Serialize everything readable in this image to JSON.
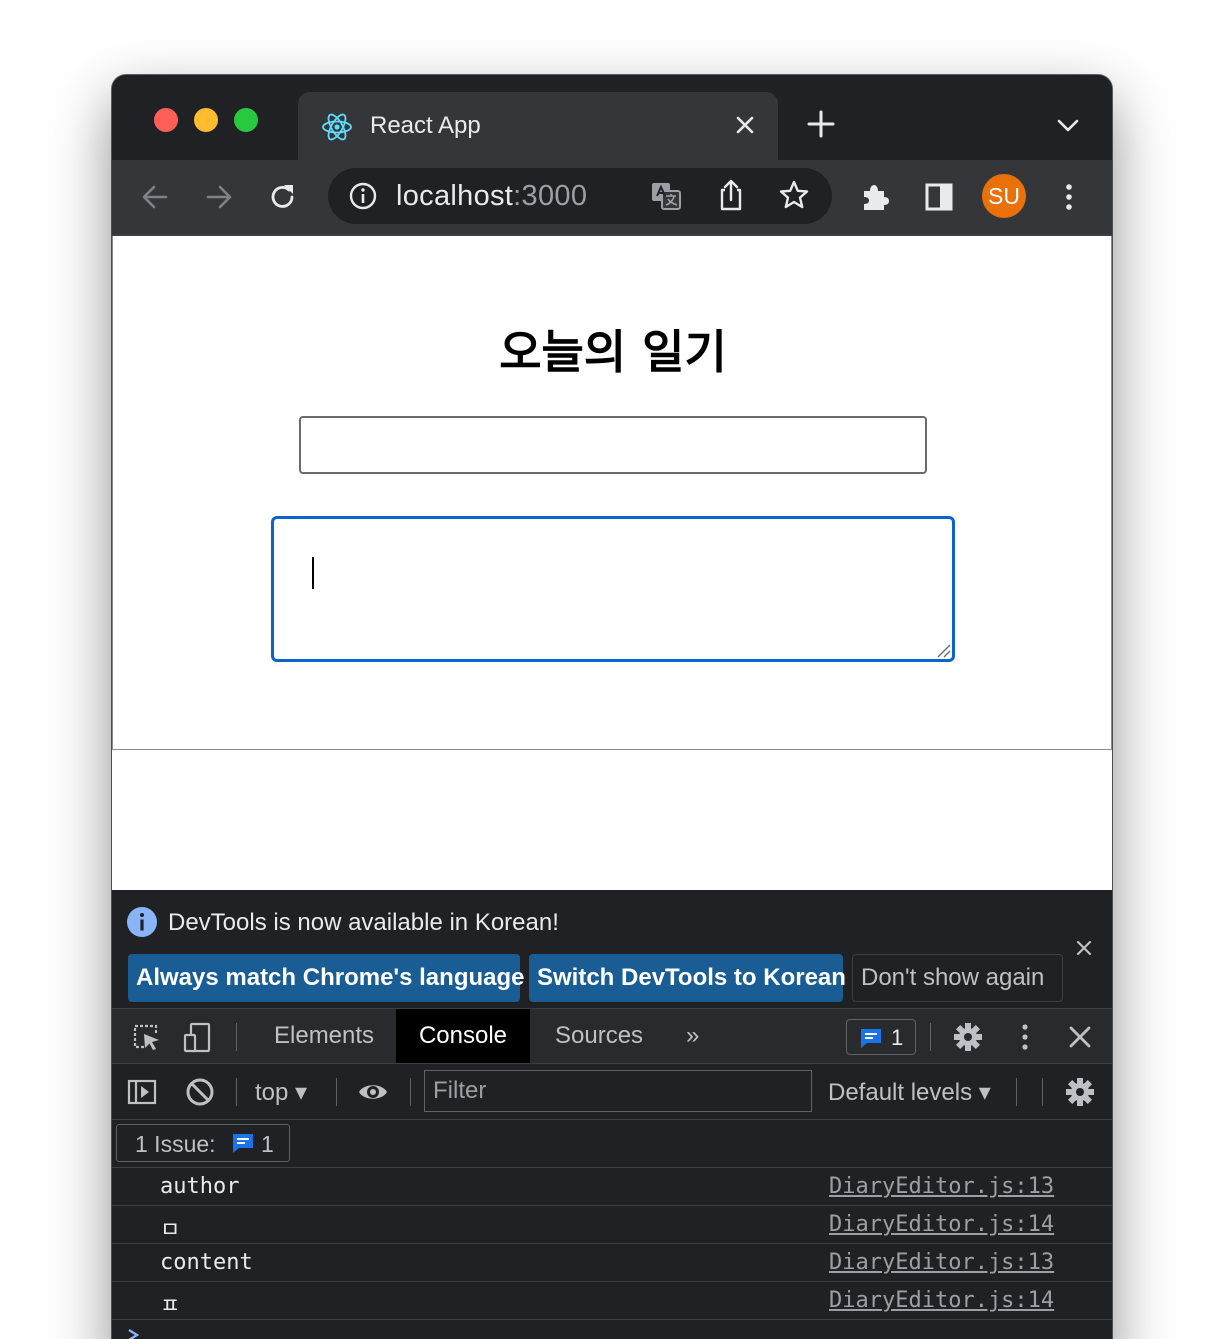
{
  "browser": {
    "tab_title": "React App",
    "url_host": "localhost",
    "url_port": ":3000",
    "profile_initials": "SU",
    "profile_color": "#e8710a"
  },
  "page": {
    "title": "오늘의 일기",
    "author_value": "",
    "content_value": ""
  },
  "devtools": {
    "infobar": {
      "message": "DevTools is now available in Korean!",
      "buttons": [
        "Always match Chrome's language",
        "Switch DevTools to Korean",
        "Don't show again"
      ]
    },
    "tabs": [
      "Elements",
      "Console",
      "Sources"
    ],
    "active_tab": "Console",
    "overflow_label": "»",
    "issue_count": "1",
    "console": {
      "context": "top",
      "filter_placeholder": "Filter",
      "levels": "Default levels",
      "issues_label": "1 Issue:",
      "issues_count": "1"
    },
    "logs": [
      {
        "message": "author",
        "source": "DiaryEditor.js:13"
      },
      {
        "message": "ㅁ",
        "source": "DiaryEditor.js:14"
      },
      {
        "message": "content",
        "source": "DiaryEditor.js:13"
      },
      {
        "message": "ㅍ",
        "source": "DiaryEditor.js:14"
      }
    ]
  },
  "colors": {
    "focus_ring": "#0b63ce",
    "primary_button": "#1a5d95",
    "active_tab_bg": "#000000"
  }
}
